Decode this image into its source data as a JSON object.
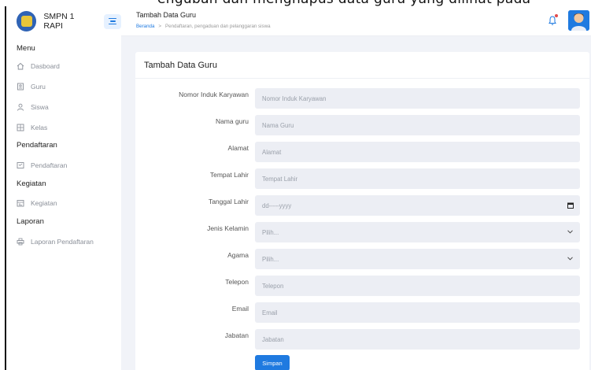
{
  "caption": "engubah dan menghapus data guru yang dilihat pada",
  "sidebar": {
    "brand": "SMPN 1 RAPI",
    "sections": {
      "menu": "Menu",
      "pendaftaran": "Pendaftaran",
      "kegiatan": "Kegiatan",
      "laporan": "Laporan"
    },
    "items": [
      {
        "label": "Dasboard",
        "icon": "home-icon"
      },
      {
        "label": "Guru",
        "icon": "id-card-icon"
      },
      {
        "label": "Siswa",
        "icon": "user-icon"
      },
      {
        "label": "Kelas",
        "icon": "grid-icon"
      },
      {
        "label": "Pendaftaran",
        "icon": "form-icon"
      },
      {
        "label": "Kegiatan",
        "icon": "calendar-icon"
      },
      {
        "label": "Laporan Pendaftaran",
        "icon": "printer-icon"
      }
    ]
  },
  "header": {
    "title": "Tambah Data Guru",
    "breadcrumb_home": "Beranda",
    "breadcrumb_sep": ">",
    "breadcrumb_current": "Pendaftaran, pengaduan dan pelanggaran siswa"
  },
  "form": {
    "title": "Tambah Data Guru",
    "fields": [
      {
        "label": "Nomor Induk Karyawan",
        "placeholder": "Nomor Induk Karyawan"
      },
      {
        "label": "Nama guru",
        "placeholder": "Nama Guru"
      },
      {
        "label": "Alamat",
        "placeholder": "Alamat"
      },
      {
        "label": "Tempat Lahir",
        "placeholder": "Tempat Lahir"
      },
      {
        "label": "Tanggal Lahir",
        "placeholder": "dd-----yyyy"
      },
      {
        "label": "Jenis Kelamin",
        "placeholder": "Pilih..."
      },
      {
        "label": "Agama",
        "placeholder": "Pilih..."
      },
      {
        "label": "Telepon",
        "placeholder": "Telepon"
      },
      {
        "label": "Email",
        "placeholder": "Email"
      },
      {
        "label": "Jabatan",
        "placeholder": "Jabatan"
      }
    ],
    "submit_label": "Simpan"
  },
  "colors": {
    "accent": "#1f7ae0",
    "background": "#f1f3f8",
    "input_bg": "#eceef4"
  }
}
